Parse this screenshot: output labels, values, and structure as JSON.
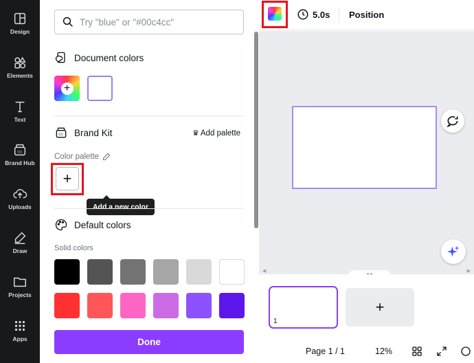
{
  "sidebar": {
    "items": [
      {
        "label": "Design",
        "icon": "design-icon"
      },
      {
        "label": "Elements",
        "icon": "elements-icon"
      },
      {
        "label": "Text",
        "icon": "text-icon"
      },
      {
        "label": "Brand Hub",
        "icon": "brand-hub-icon"
      },
      {
        "label": "Uploads",
        "icon": "uploads-icon"
      },
      {
        "label": "Draw",
        "icon": "draw-icon"
      },
      {
        "label": "Projects",
        "icon": "projects-icon"
      },
      {
        "label": "Apps",
        "icon": "apps-icon"
      }
    ]
  },
  "panel": {
    "search": {
      "placeholder": "Try \"blue\" or \"#00c4cc\"",
      "value": ""
    },
    "document_colors": {
      "title": "Document colors",
      "swatches": [
        "#ffffff"
      ]
    },
    "brand_kit": {
      "title": "Brand Kit",
      "add_palette_label": "Add palette",
      "palette_label": "Color palette"
    },
    "tooltip": "Add a new color",
    "default_colors": {
      "title": "Default colors",
      "solid_label": "Solid colors",
      "swatches": [
        [
          "#000000",
          "#545454",
          "#737373",
          "#a6a6a6",
          "#d9d9d9",
          "#ffffff"
        ],
        [
          "#ff3131",
          "#ff5757",
          "#ff66c4",
          "#cb6ce6",
          "#8c52ff",
          "#5e17eb"
        ]
      ]
    },
    "done_label": "Done"
  },
  "toolbar": {
    "duration": "5.0s",
    "position_label": "Position"
  },
  "footer": {
    "page_thumb_number": "1",
    "page_indicator": "Page 1 / 1",
    "zoom": "12%"
  },
  "colors": {
    "accent": "#8b3dff",
    "highlight": "#e8141b",
    "rail_bg": "#18191b",
    "canvas_bg": "#ebecf0"
  }
}
